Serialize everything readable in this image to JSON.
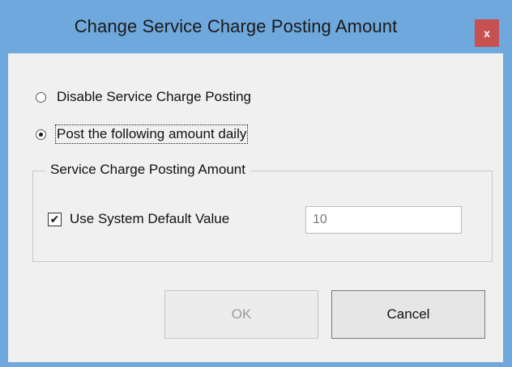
{
  "window": {
    "title": "Change Service Charge Posting Amount",
    "close_glyph": "x"
  },
  "options": {
    "disable_label": "Disable Service Charge Posting",
    "post_daily_label": "Post the following amount daily",
    "selected": "post_daily"
  },
  "group": {
    "legend": "Service Charge Posting Amount",
    "use_default_label": "Use System Default Value",
    "use_default_checked": true,
    "amount_value": "10"
  },
  "buttons": {
    "ok_label": "OK",
    "ok_enabled": false,
    "cancel_label": "Cancel"
  },
  "colors": {
    "title_bar": "#6fa8dc",
    "close_button": "#c75050",
    "dialog_background": "#f0f0f0"
  },
  "icons": {
    "close": "close-icon",
    "check": "checkmark-icon"
  }
}
